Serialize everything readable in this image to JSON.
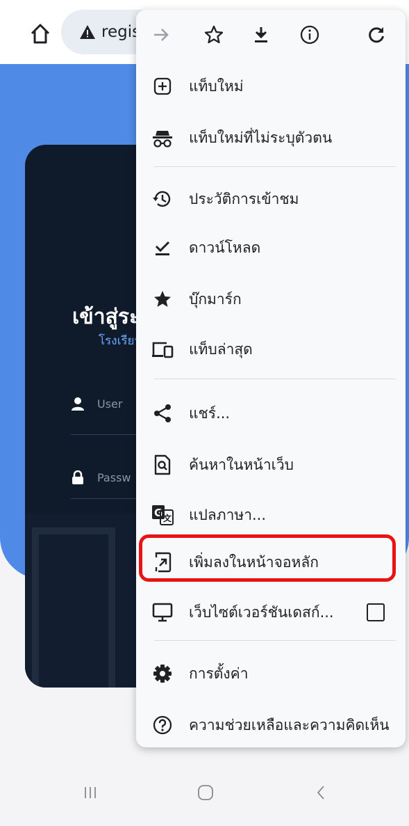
{
  "browser": {
    "url_text": "regist",
    "toolbar": {
      "forward_icon": "arrow-forward-icon",
      "bookmark_icon": "star-outline-icon",
      "download_icon": "download-icon",
      "info_icon": "info-icon",
      "reload_icon": "reload-icon"
    }
  },
  "page": {
    "login_title": "เข้าสู่ระบ",
    "login_subtitle": "โรงเรียน",
    "username_placeholder": "User",
    "password_placeholder": "Passw"
  },
  "menu": {
    "items": [
      {
        "label": "แท็บใหม่",
        "icon": "plus-box-icon"
      },
      {
        "label": "แท็บใหม่ที่ไม่ระบุตัวตน",
        "icon": "incognito-icon"
      },
      {
        "label": "ประวัติการเข้าชม",
        "icon": "history-icon"
      },
      {
        "label": "ดาวน์โหลด",
        "icon": "download-done-icon"
      },
      {
        "label": "บุ๊กมาร์ก",
        "icon": "star-icon"
      },
      {
        "label": "แท็บล่าสุด",
        "icon": "devices-icon"
      },
      {
        "label": "แชร์...",
        "icon": "share-icon"
      },
      {
        "label": "ค้นหาในหน้าเว็บ",
        "icon": "find-in-page-icon"
      },
      {
        "label": "แปลภาษา...",
        "icon": "translate-icon"
      },
      {
        "label": "เพิ่มลงในหน้าจอหลัก",
        "icon": "add-to-home-icon"
      },
      {
        "label": "เว็บไซต์เวอร์ชันเดสก์...",
        "icon": "desktop-icon"
      },
      {
        "label": "การตั้งค่า",
        "icon": "gear-icon"
      },
      {
        "label": "ความช่วยเหลือและความคิดเห็น",
        "icon": "help-icon"
      }
    ],
    "highlight_color": "#e81414"
  },
  "nav": {
    "recents_icon": "recents-icon",
    "home_icon": "home-nav-icon",
    "back_icon": "back-icon"
  }
}
